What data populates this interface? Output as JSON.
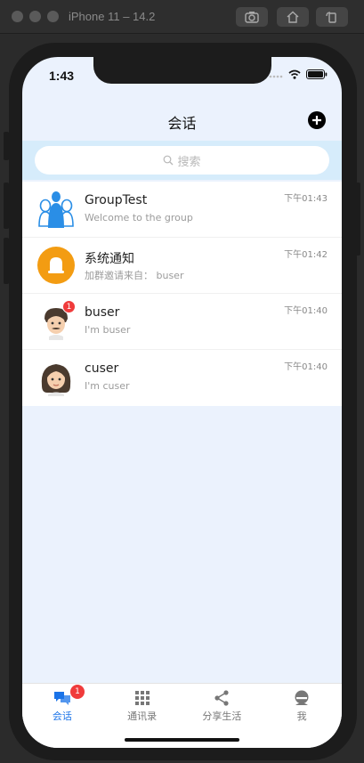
{
  "window": {
    "title": "iPhone 11 – 14.2"
  },
  "status": {
    "time": "1:43"
  },
  "header": {
    "title": "会话"
  },
  "search": {
    "placeholder": "搜索"
  },
  "conversations": [
    {
      "title": "GroupTest",
      "subtitle": "Welcome to the group",
      "time": "下午01:43",
      "avatar": "group-icon",
      "badge": ""
    },
    {
      "title": "系统通知",
      "subtitle": "加群邀请来自：  buser",
      "time": "下午01:42",
      "avatar": "bell-icon",
      "badge": ""
    },
    {
      "title": "buser",
      "subtitle": "I'm buser",
      "time": "下午01:40",
      "avatar": "male-avatar",
      "badge": "1"
    },
    {
      "title": "cuser",
      "subtitle": "I'm cuser",
      "time": "下午01:40",
      "avatar": "female-avatar",
      "badge": ""
    }
  ],
  "tabs": [
    {
      "label": "会话",
      "icon": "chat-icon",
      "active": true,
      "badge": "1"
    },
    {
      "label": "通讯录",
      "icon": "grid-icon",
      "active": false
    },
    {
      "label": "分享生活",
      "icon": "share-icon",
      "active": false
    },
    {
      "label": "我",
      "icon": "user-icon",
      "active": false
    }
  ],
  "colors": {
    "accent": "#1a73e8",
    "badge": "#f03b3b",
    "background": "#ebf2fd",
    "search_bar": "#d6ecfb"
  }
}
